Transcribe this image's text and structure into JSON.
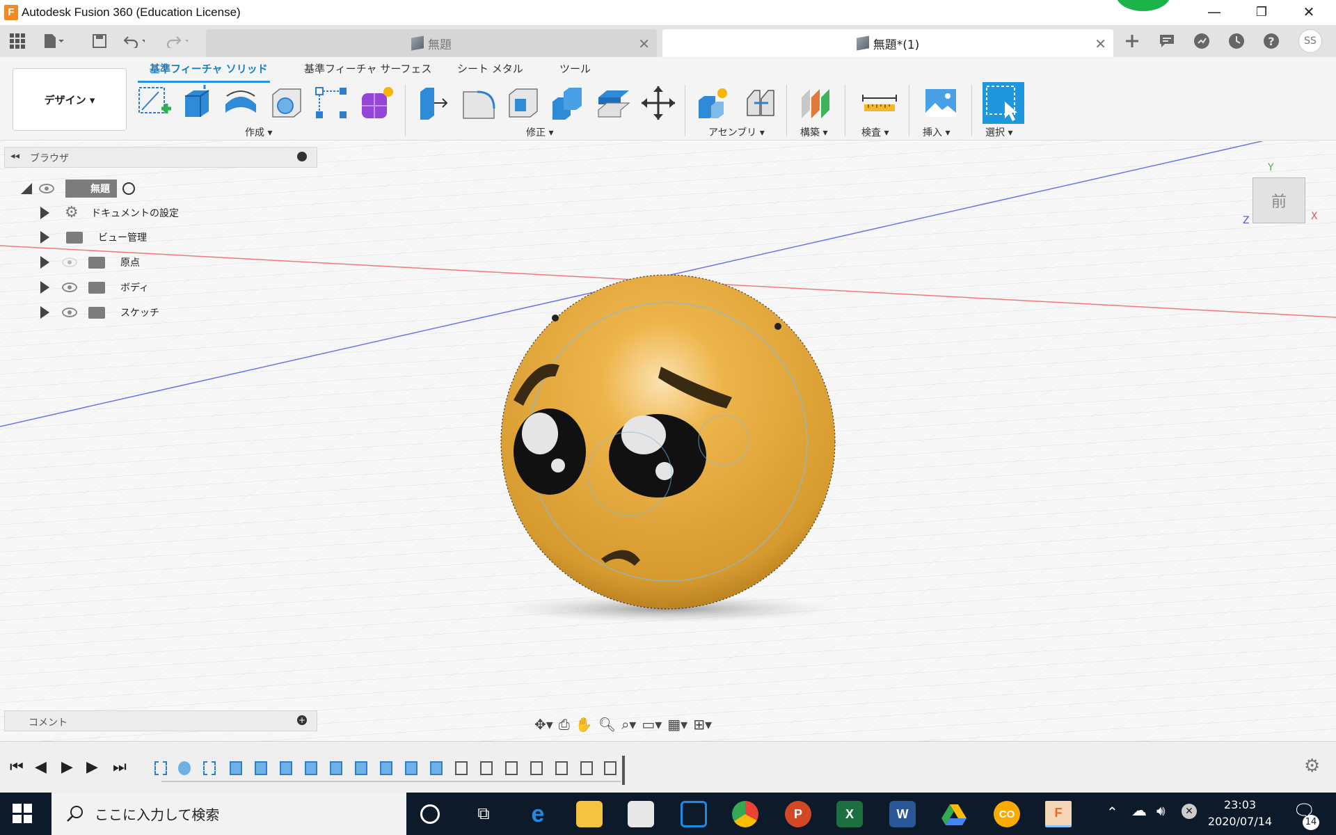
{
  "window": {
    "title": "Autodesk Fusion 360 (Education License)",
    "logo_letter": "F",
    "minimize": "—",
    "restore": "❐",
    "close": "✕"
  },
  "tabs": {
    "inactive_title": "無題",
    "active_title": "無題*(1)",
    "close_glyph": "✕",
    "user_initials": "SS"
  },
  "ribbon": {
    "workspace": "デザイン ▾",
    "tabs": [
      "基準フィーチャ ソリッド",
      "基準フィーチャ サーフェス",
      "シート メタル",
      "ツール"
    ],
    "groups": [
      "作成 ▾",
      "修正 ▾",
      "アセンブリ ▾",
      "構築 ▾",
      "検査 ▾",
      "挿入 ▾",
      "選択 ▾"
    ]
  },
  "browser": {
    "title": "ブラウザ",
    "root": "無題",
    "items": [
      "ドキュメントの設定",
      "ビュー管理",
      "原点",
      "ボディ",
      "スケッチ"
    ]
  },
  "comments": {
    "title": "コメント"
  },
  "viewcube": {
    "face": "前",
    "axis_x": "X",
    "axis_y": "Y",
    "axis_z": "Z"
  },
  "taskbar": {
    "search_placeholder": "ここに入力して検索",
    "time": "23:03",
    "date": "2020/07/14",
    "notification_count": "14"
  },
  "colors": {
    "accent": "#1f97df",
    "ball": "#e8a93c",
    "taskbar": "#0c1a2a"
  }
}
